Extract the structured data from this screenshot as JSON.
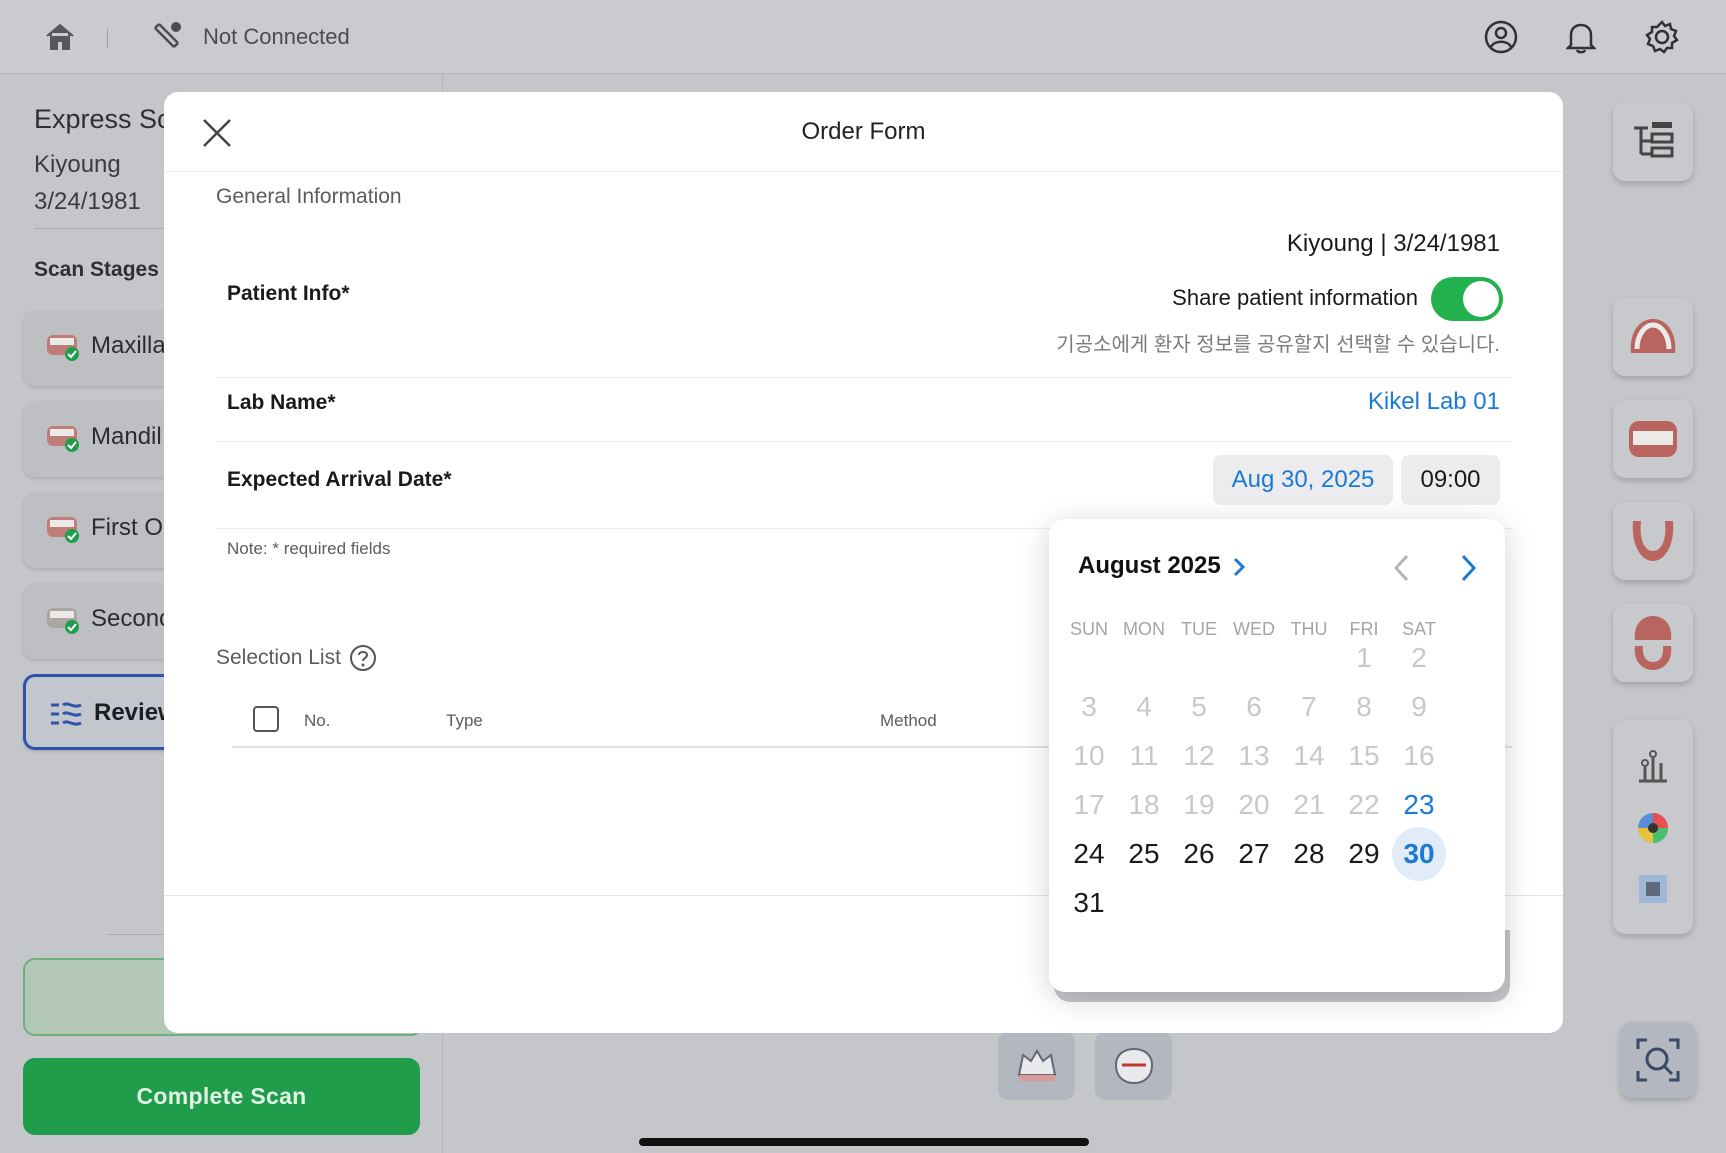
{
  "topbar": {
    "connection_status": "Not Connected",
    "icons": [
      "home-icon",
      "scanner-icon",
      "profile-icon",
      "bell-icon",
      "gear-icon"
    ]
  },
  "left_panel": {
    "title": "Express Sca",
    "patient_name": "Kiyoung",
    "patient_dob": "3/24/1981",
    "stages_title": "Scan Stages (",
    "stages": [
      {
        "label": "Maxilla",
        "done": true
      },
      {
        "label": "Mandil",
        "done": true
      },
      {
        "label": "First O",
        "done": true
      },
      {
        "label": "Seconc",
        "done": true
      },
      {
        "label": "Review",
        "active": true
      }
    ],
    "complete_button": "Complete Scan"
  },
  "modal": {
    "title": "Order Form",
    "general_info_title": "General Information",
    "patient_info_label": "Patient Info*",
    "patient_info_value": "Kiyoung | 3/24/1981",
    "share_label": "Share patient information",
    "share_enabled": true,
    "share_description": "기공소에게 환자 정보를 공유할지 선택할 수 있습니다.",
    "lab_name_label": "Lab Name*",
    "lab_name_value": "Kikel Lab 01",
    "arrival_label": "Expected Arrival Date*",
    "arrival_date": "Aug 30, 2025",
    "arrival_time": "09:00",
    "note": "Note: * required fields",
    "selection_list_title": "Selection List",
    "table_headers": {
      "no": "No.",
      "type": "Type",
      "method": "Method"
    }
  },
  "calendar": {
    "month_label": "August 2025",
    "weekdays": [
      "SUN",
      "MON",
      "TUE",
      "WED",
      "THU",
      "FRI",
      "SAT"
    ],
    "first_weekday_index": 5,
    "days_in_month": 31,
    "today": 23,
    "selected": 30,
    "first_available": 24
  },
  "colors": {
    "accent_blue": "#1a7ad6",
    "toggle_green": "#22b14c",
    "complete_green": "#1f9d4b"
  }
}
